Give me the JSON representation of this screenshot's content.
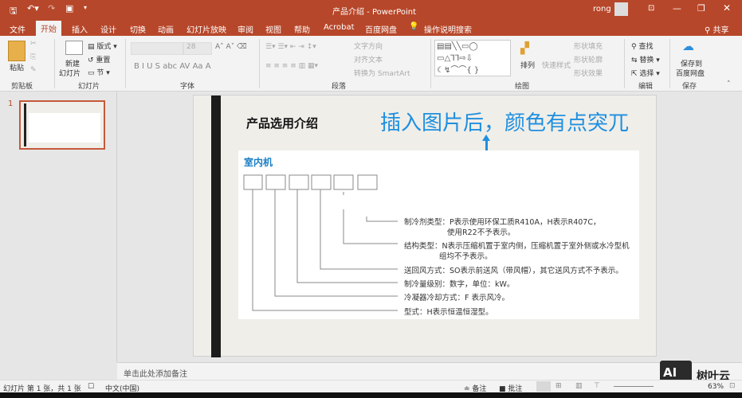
{
  "titlebar": {
    "title": "产品介绍 - PowerPoint",
    "user": "rong",
    "qat": [
      "save-icon",
      "undo-icon",
      "redo-icon",
      "present-icon",
      "customize-icon"
    ]
  },
  "tabs": [
    "文件",
    "开始",
    "插入",
    "设计",
    "切换",
    "动画",
    "幻灯片放映",
    "审阅",
    "视图",
    "帮助",
    "Acrobat",
    "百度网盘",
    "操作说明搜索"
  ],
  "share": "共享",
  "ribbon": {
    "clipboard": {
      "paste": "粘贴",
      "group": "剪贴板"
    },
    "slides": {
      "new": "新建",
      "new2": "幻灯片",
      "layout": "版式",
      "reset": "重置",
      "section": "节",
      "group": "幻灯片"
    },
    "font": {
      "size": "28",
      "group": "字体"
    },
    "paragraph": {
      "text_dir": "文字方向",
      "align": "对齐文本",
      "smartart": "转换为 SmartArt",
      "group": "段落"
    },
    "drawing": {
      "arrange": "排列",
      "quick": "快速样式",
      "fill": "形状填充",
      "outline": "形状轮廓",
      "effect": "形状效果",
      "group": "绘图"
    },
    "editing": {
      "find": "查找",
      "replace": "替换",
      "select": "选择",
      "group": "编辑"
    },
    "save": {
      "l1": "保存到",
      "l2": "百度网盘",
      "group": "保存"
    }
  },
  "thumb": {
    "number": "1"
  },
  "slide": {
    "title": "产品选用介绍",
    "annotation": "插入图片后，颜色有点突兀",
    "image": {
      "heading": "室内机",
      "labels": [
        "制冷剂类型：P表示使用环保工质R410A，H表示R407C，",
        "使用R22不予表示。",
        "结构类型：N表示压缩机置于室内侧，压缩机置于室外侧或水冷型机",
        "组均不予表示。",
        "送回风方式：SO表示前送风（带风帽），其它送风方式不予表示。",
        "制冷量级别：数字，单位：kW。",
        "冷凝器冷却方式：F 表示风冷。",
        "型式：H表示恒温恒湿型。"
      ]
    }
  },
  "notes": {
    "placeholder": "单击此处添加备注"
  },
  "status": {
    "slide": "幻灯片 第 1 张，共 1 张",
    "lang": "中文(中国)",
    "notes": "备注",
    "comments": "批注",
    "zoom": "63%"
  },
  "watermark": "树叶云",
  "colors": {
    "accent": "#b7472a",
    "annotation": "#1e8fe0",
    "heading": "#1a7fc4"
  }
}
